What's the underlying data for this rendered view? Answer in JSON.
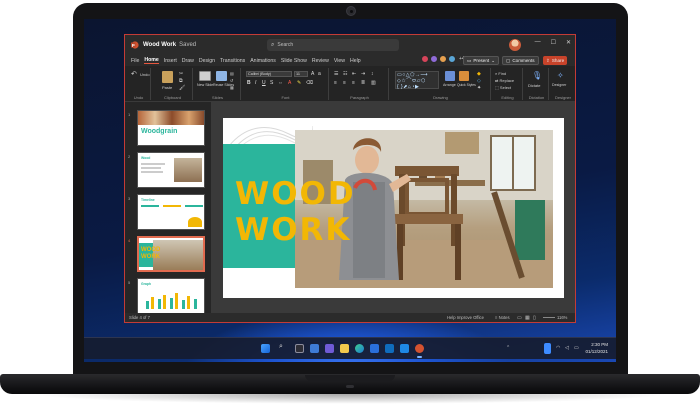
{
  "window": {
    "file_name": "Wood Work",
    "save_state": "Saved",
    "search_placeholder": "Search",
    "collaborators_more": "+4",
    "present_label": "Present",
    "comments_label": "Comments",
    "share_label": "Share"
  },
  "menu": {
    "tabs": [
      "File",
      "Home",
      "Insert",
      "Draw",
      "Design",
      "Transitions",
      "Animations",
      "Slide Show",
      "Review",
      "View",
      "Help"
    ],
    "active": "Home"
  },
  "ribbon": {
    "undo_label": "Undo",
    "paste_label": "Paste",
    "new_slide_label": "New Slide",
    "reuse_slides_label": "Reuse Slides",
    "font_name": "Calibri (Body)",
    "font_size": "11",
    "arrange_label": "Arrange",
    "quick_styles_label": "Quick Styles",
    "find_label": "Find",
    "replace_label": "Replace",
    "select_label": "Select",
    "dictate_label": "Dictate",
    "designer_label": "Designer",
    "groups": [
      "Undo",
      "Clipboard",
      "Slides",
      "Font",
      "Paragraph",
      "Drawing",
      "Editing",
      "Dictation",
      "Designer"
    ]
  },
  "thumbnails": [
    {
      "num": "1",
      "title": "Woodgrain"
    },
    {
      "num": "2",
      "title": "Wood"
    },
    {
      "num": "3",
      "title": "Timeline"
    },
    {
      "num": "4",
      "title": "WOOD WORK"
    },
    {
      "num": "5",
      "title": "Graph"
    }
  ],
  "slide": {
    "title_line1": "WOOD",
    "title_line2": "WORK"
  },
  "status": {
    "slide_position": "Slide 4 of 7",
    "help_improve": "Help Improve Office",
    "notes_label": "Notes",
    "zoom": "116%"
  },
  "taskbar": {
    "time": "2:30 PM",
    "date": "01/12/2021"
  },
  "colors": {
    "accent_red": "#c43b36",
    "teal": "#2bb59c",
    "title_yellow": "#f2b705",
    "share_orange": "#c8432a"
  }
}
